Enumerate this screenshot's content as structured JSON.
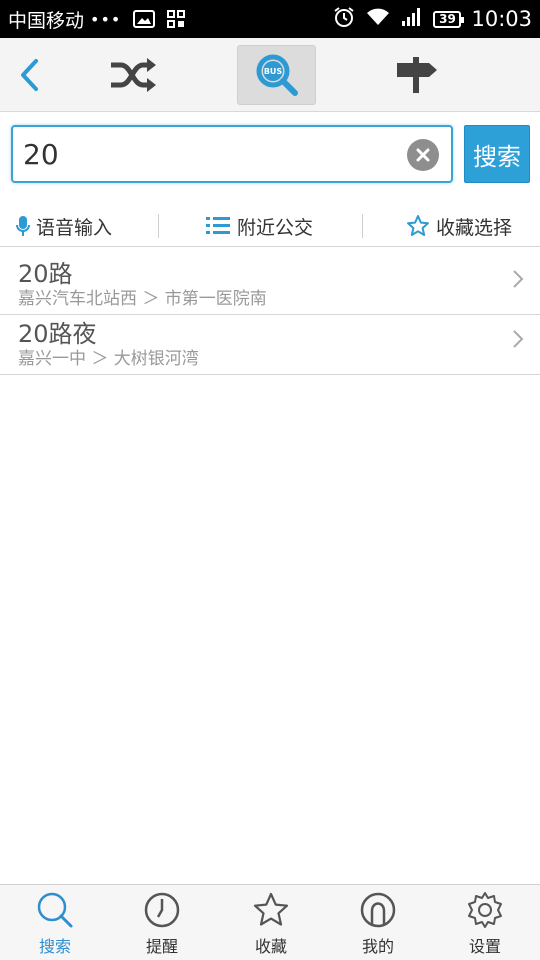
{
  "status_bar": {
    "carrier": "中国移动",
    "dots": "•••",
    "battery": "39",
    "time": "10:03"
  },
  "top_nav": {
    "icons": [
      "back-arrow-icon",
      "shuffle-icon",
      "bus-search-icon",
      "signpost-icon"
    ],
    "bus_badge": "BUS"
  },
  "search": {
    "value": "20",
    "button_label": "搜索"
  },
  "options": {
    "voice_label": "语音输入",
    "nearby_label": "附近公交",
    "favorite_label": "收藏选择"
  },
  "results": [
    {
      "name": "20路",
      "route": "嘉兴汽车北站西 ＞ 市第一医院南"
    },
    {
      "name": "20路夜",
      "route": "嘉兴一中 ＞ 大树银河湾"
    }
  ],
  "tabs": [
    {
      "label": "搜索",
      "icon": "search-icon",
      "active": true
    },
    {
      "label": "提醒",
      "icon": "clock-icon"
    },
    {
      "label": "收藏",
      "icon": "star-icon"
    },
    {
      "label": "我的",
      "icon": "user-icon"
    },
    {
      "label": "设置",
      "icon": "gear-icon"
    }
  ],
  "colors": {
    "accent": "#2ea0d8",
    "active_tab": "#2e8fcf",
    "status_bar": "#000000"
  }
}
